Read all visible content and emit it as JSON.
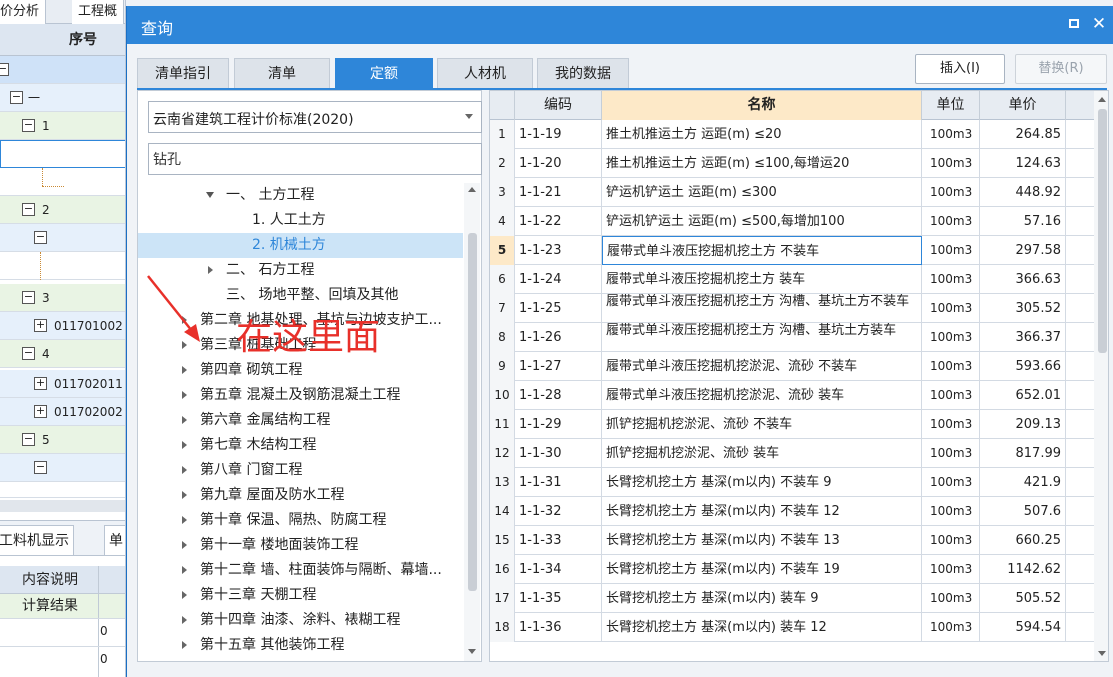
{
  "background_app": {
    "tabs": [
      "价分析",
      "工程概"
    ],
    "column_header": "序号",
    "rows": [
      {
        "label": "一"
      },
      {
        "label": "1"
      },
      {
        "label": ""
      },
      {
        "label": ""
      },
      {
        "label": "2"
      },
      {
        "label": ""
      },
      {
        "label": ""
      },
      {
        "label": "3"
      },
      {
        "label": "011701002"
      },
      {
        "label": "4"
      },
      {
        "label": "011702011"
      },
      {
        "label": "011702002"
      },
      {
        "label": "5"
      },
      {
        "label": ""
      }
    ],
    "bottom_tabs": [
      "工料机显示",
      "单"
    ],
    "bottom_header": "内容说明",
    "calc_result": "计算结果",
    "zeros": [
      "0",
      "0"
    ]
  },
  "dialog": {
    "title": "查询",
    "tabs": [
      {
        "label": "清单指引",
        "active": false
      },
      {
        "label": "清单",
        "active": false
      },
      {
        "label": "定额",
        "active": true
      },
      {
        "label": "人材机",
        "active": false
      },
      {
        "label": "我的数据",
        "active": false
      }
    ],
    "insert_button": "插入(I)",
    "replace_button": "替换(R)",
    "standard_select": "云南省建筑工程计价标准(2020)",
    "search_value": "钻孔",
    "tree": [
      {
        "label": "一、 土方工程",
        "level": 1,
        "state": "expanded"
      },
      {
        "label": "1. 人工土方",
        "level": 2,
        "state": "leaf"
      },
      {
        "label": "2. 机械土方",
        "level": 2,
        "state": "leaf",
        "selected": true
      },
      {
        "label": "二、 石方工程",
        "level": 1,
        "state": "collapsed"
      },
      {
        "label": "三、 场地平整、回填及其他",
        "level": 1,
        "state": "leaf"
      },
      {
        "label": "第二章 地基处理、基坑与边坡支护工...",
        "level": 0,
        "state": "collapsed"
      },
      {
        "label": "第三章 桩基础工程",
        "level": 0,
        "state": "collapsed"
      },
      {
        "label": "第四章 砌筑工程",
        "level": 0,
        "state": "collapsed"
      },
      {
        "label": "第五章 混凝土及钢筋混凝土工程",
        "level": 0,
        "state": "collapsed"
      },
      {
        "label": "第六章 金属结构工程",
        "level": 0,
        "state": "collapsed"
      },
      {
        "label": "第七章 木结构工程",
        "level": 0,
        "state": "collapsed"
      },
      {
        "label": "第八章 门窗工程",
        "level": 0,
        "state": "collapsed"
      },
      {
        "label": "第九章 屋面及防水工程",
        "level": 0,
        "state": "collapsed"
      },
      {
        "label": "第十章 保温、隔热、防腐工程",
        "level": 0,
        "state": "collapsed"
      },
      {
        "label": "第十一章 楼地面装饰工程",
        "level": 0,
        "state": "collapsed"
      },
      {
        "label": "第十二章 墙、柱面装饰与隔断、幕墙...",
        "level": 0,
        "state": "collapsed"
      },
      {
        "label": "第十三章 天棚工程",
        "level": 0,
        "state": "collapsed"
      },
      {
        "label": "第十四章 油漆、涂料、裱糊工程",
        "level": 0,
        "state": "collapsed"
      },
      {
        "label": "第十五章 其他装饰工程",
        "level": 0,
        "state": "collapsed"
      }
    ],
    "annotation": "在这里面",
    "grid": {
      "headers": [
        "",
        "编码",
        "名称",
        "单位",
        "单价"
      ],
      "rows": [
        {
          "n": "1",
          "code": "1-1-19",
          "name": "推土机推运土方 运距(m) ≤20",
          "unit": "100m3",
          "price": "264.85"
        },
        {
          "n": "2",
          "code": "1-1-20",
          "name": "推土机推运土方 运距(m) ≤100,每增运20",
          "unit": "100m3",
          "price": "124.63"
        },
        {
          "n": "3",
          "code": "1-1-21",
          "name": "铲运机铲运土 运距(m) ≤300",
          "unit": "100m3",
          "price": "448.92"
        },
        {
          "n": "4",
          "code": "1-1-22",
          "name": "铲运机铲运土 运距(m) ≤500,每增加100",
          "unit": "100m3",
          "price": "57.16"
        },
        {
          "n": "5",
          "code": "1-1-23",
          "name": "履带式单斗液压挖掘机挖土方 不装车",
          "unit": "100m3",
          "price": "297.58",
          "current": true
        },
        {
          "n": "6",
          "code": "1-1-24",
          "name": "履带式单斗液压挖掘机挖土方 装车",
          "unit": "100m3",
          "price": "366.63"
        },
        {
          "n": "7",
          "code": "1-1-25",
          "name": "履带式单斗液压挖掘机挖土方 沟槽、基坑土方不装车",
          "unit": "100m3",
          "price": "305.52",
          "twoline": true
        },
        {
          "n": "8",
          "code": "1-1-26",
          "name": "履带式单斗液压挖掘机挖土方 沟槽、基坑土方装车",
          "unit": "100m3",
          "price": "366.37",
          "twoline": true
        },
        {
          "n": "9",
          "code": "1-1-27",
          "name": "履带式单斗液压挖掘机挖淤泥、流砂 不装车",
          "unit": "100m3",
          "price": "593.66"
        },
        {
          "n": "10",
          "code": "1-1-28",
          "name": "履带式单斗液压挖掘机挖淤泥、流砂 装车",
          "unit": "100m3",
          "price": "652.01"
        },
        {
          "n": "11",
          "code": "1-1-29",
          "name": "抓铲挖掘机挖淤泥、流砂 不装车",
          "unit": "100m3",
          "price": "209.13"
        },
        {
          "n": "12",
          "code": "1-1-30",
          "name": "抓铲挖掘机挖淤泥、流砂 装车",
          "unit": "100m3",
          "price": "817.99"
        },
        {
          "n": "13",
          "code": "1-1-31",
          "name": "长臂挖机挖土方 基深(m以内) 不装车 9",
          "unit": "100m3",
          "price": "421.9"
        },
        {
          "n": "14",
          "code": "1-1-32",
          "name": "长臂挖机挖土方 基深(m以内) 不装车 12",
          "unit": "100m3",
          "price": "507.6"
        },
        {
          "n": "15",
          "code": "1-1-33",
          "name": "长臂挖机挖土方 基深(m以内) 不装车 13",
          "unit": "100m3",
          "price": "660.25"
        },
        {
          "n": "16",
          "code": "1-1-34",
          "name": "长臂挖机挖土方 基深(m以内) 不装车 19",
          "unit": "100m3",
          "price": "1142.62"
        },
        {
          "n": "17",
          "code": "1-1-35",
          "name": "长臂挖机挖土方 基深(m以内) 装车 9",
          "unit": "100m3",
          "price": "505.52"
        },
        {
          "n": "18",
          "code": "1-1-36",
          "name": "长臂挖机挖土方 基深(m以内) 装车 12",
          "unit": "100m3",
          "price": "594.54"
        }
      ]
    }
  },
  "colors": {
    "accent": "#2e86d9",
    "name_header": "#fde9c8",
    "annotation": "#e8302a"
  }
}
